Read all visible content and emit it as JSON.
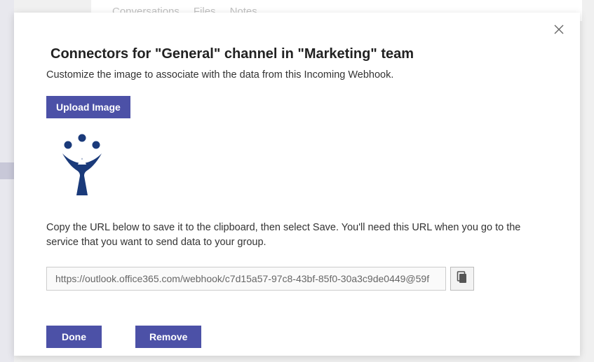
{
  "background": {
    "tabs": [
      "Conversations",
      "Files",
      "Notes"
    ]
  },
  "modal": {
    "title": "Connectors for \"General\" channel in \"Marketing\" team",
    "subtitle": "Customize the image to associate with the data from this Incoming Webhook.",
    "upload_label": "Upload Image",
    "url_description": "Copy the URL below to save it to the clipboard, then select Save. You'll need this URL when you go to the service that you want to send data to your group.",
    "webhook_url": "https://outlook.office365.com/webhook/c7d15a57-97c8-43bf-85f0-30a3c9de0449@59f",
    "done_label": "Done",
    "remove_label": "Remove"
  }
}
